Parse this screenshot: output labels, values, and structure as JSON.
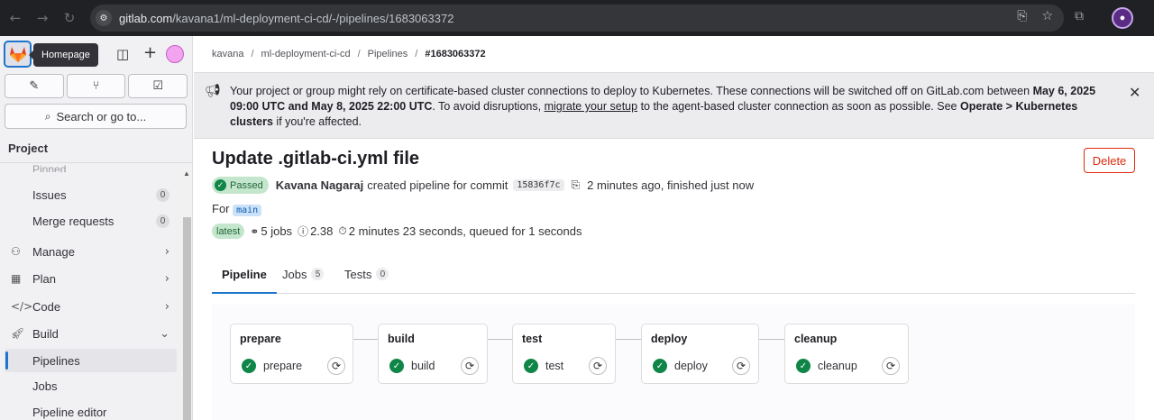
{
  "browser": {
    "url_domain": "gitlab.com",
    "url_path": "/kavana1/ml-deployment-ci-cd/-/pipelines/1683063372"
  },
  "sidebar": {
    "tooltip": "Homepage",
    "search_label": "Search or go to...",
    "section_title": "Project",
    "pinned_label": "Pinned",
    "items": [
      {
        "label": "Issues",
        "count": "0"
      },
      {
        "label": "Merge requests",
        "count": "0"
      },
      {
        "label": "Manage"
      },
      {
        "label": "Plan"
      },
      {
        "label": "Code"
      },
      {
        "label": "Build"
      },
      {
        "label": "Pipelines"
      },
      {
        "label": "Jobs"
      },
      {
        "label": "Pipeline editor"
      }
    ]
  },
  "breadcrumb": {
    "items": [
      "kavana",
      "ml-deployment-ci-cd",
      "Pipelines",
      "#1683063372"
    ]
  },
  "alert": {
    "part1": "Your project or group might rely on certificate-based cluster connections to deploy to Kubernetes. These connections will be switched off on GitLab.com between ",
    "bold1": "May 6, 2025 09:00 UTC and May 8, 2025 22:00 UTC",
    "part2": ". To avoid disruptions, ",
    "link": "migrate your setup",
    "part3": " to the agent-based cluster connection as soon as possible. See ",
    "bold2": "Operate > Kubernetes clusters",
    "part4": " if you're affected."
  },
  "pipeline": {
    "title": "Update .gitlab-ci.yml file",
    "delete_label": "Delete",
    "status": "Passed",
    "author": "Kavana Nagaraj",
    "created_text": "created pipeline for commit",
    "commit_sha": "15836f7c",
    "time_text": "2 minutes ago, finished just now",
    "for_label": "For",
    "branch": "main",
    "latest_badge": "latest",
    "jobs_count_text": "5 jobs",
    "compute_text": "2.38",
    "duration_text": "2 minutes 23 seconds, queued for 1 seconds"
  },
  "tabs": [
    {
      "label": "Pipeline"
    },
    {
      "label": "Jobs",
      "count": "5"
    },
    {
      "label": "Tests",
      "count": "0"
    }
  ],
  "stages": [
    {
      "name": "prepare",
      "job": "prepare"
    },
    {
      "name": "build",
      "job": "build"
    },
    {
      "name": "test",
      "job": "test"
    },
    {
      "name": "deploy",
      "job": "deploy"
    },
    {
      "name": "cleanup",
      "job": "cleanup"
    }
  ],
  "colors": {
    "accent": "#1f75cb",
    "success": "#108548",
    "danger": "#dd2b0e"
  }
}
